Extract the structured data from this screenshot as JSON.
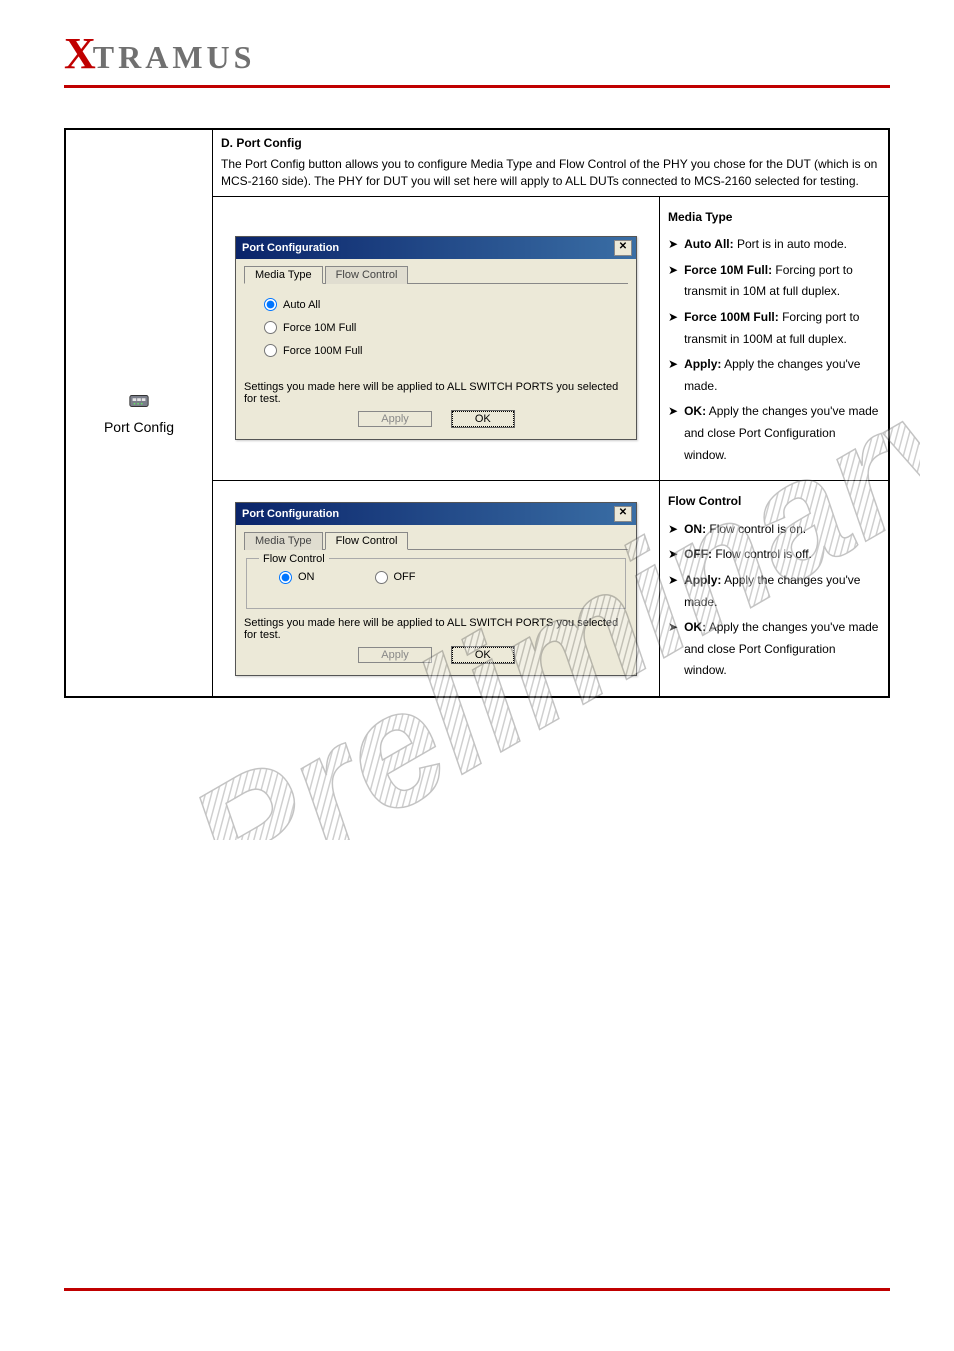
{
  "logo": {
    "x": "X",
    "rest": "TRAMUS"
  },
  "portConfig": {
    "iconName": "port-config-icon",
    "label": "Port Config"
  },
  "topCell": {
    "heading": "D. Port Config",
    "desc": "The Port Config button allows you to configure Media Type and Flow Control of the PHY you chose for the DUT (which is on MCS-2160 side). The PHY for DUT you will set here will apply to ALL DUTs connected to MCS-2160 selected for testing."
  },
  "mediaTypeRow": {
    "heading": "Media Type",
    "bullets": [
      {
        "label": "Auto All:",
        "text": " Port is in auto mode."
      },
      {
        "label": "Force 10M Full:",
        "text": " Forcing port to transmit in 10M at full duplex."
      },
      {
        "label": "Force 100M Full:",
        "text": " Forcing port to transmit in 100M at full duplex."
      },
      {
        "label": "Apply:",
        "text": " Apply the changes you've made."
      },
      {
        "label": "OK:",
        "text": " Apply the changes you've made and close Port Configuration window."
      }
    ]
  },
  "flowControlRow": {
    "heading": "Flow Control",
    "bullets": [
      {
        "label": "ON:",
        "text": " Flow control is on."
      },
      {
        "label": "OFF:",
        "text": " Flow control is off."
      },
      {
        "label": "Apply:",
        "text": " Apply the changes you've made."
      },
      {
        "label": "OK:",
        "text": " Apply the changes you've made and close Port Configuration window."
      }
    ]
  },
  "dialog": {
    "title": "Port Configuration",
    "tabs": {
      "mediaType": "Media Type",
      "flowControl": "Flow Control"
    },
    "mediaOptions": {
      "autoAll": "Auto All",
      "force10": "Force 10M Full",
      "force100": "Force 100M Full"
    },
    "flowOptions": {
      "on": "ON",
      "off": "OFF"
    },
    "flowFieldset": "Flow Control",
    "note": "Settings you made here will be applied to ALL SWITCH PORTS you selected for test.",
    "apply": "Apply",
    "ok": "OK"
  },
  "watermark": "Preliminary"
}
